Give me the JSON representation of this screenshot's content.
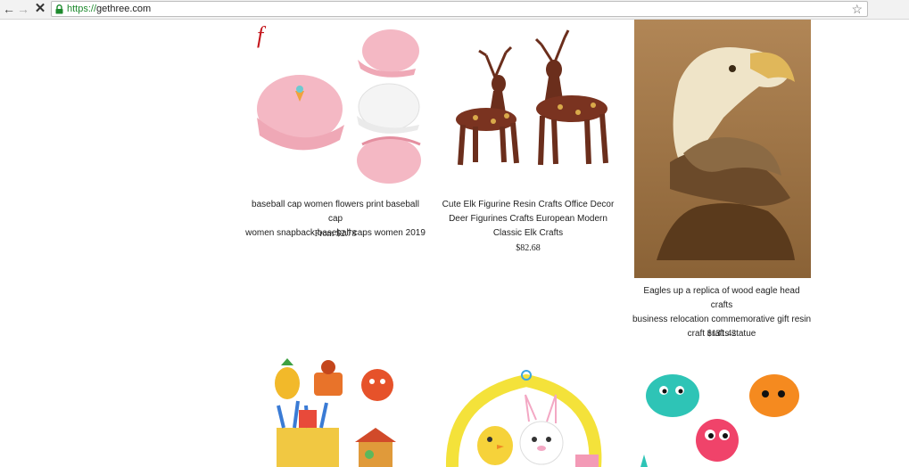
{
  "browser": {
    "url_scheme": "https://",
    "url_host": "gethree.com"
  },
  "products": [
    {
      "title_line1": "baseball cap women flowers print baseball cap",
      "title_line2": "women snapback baseball caps women 2019",
      "title_line3": "",
      "price": "From $2.78"
    },
    {
      "title_line1": "Cute Elk Figurine Resin Crafts Office Decor",
      "title_line2": "Deer Figurines Crafts European Modern",
      "title_line3": "Classic Elk Crafts",
      "price": "$82.68"
    },
    {
      "title_line1": "Eagles up a replica of wood eagle head crafts",
      "title_line2": "business relocation commemorative gift resin",
      "title_line3": "craft crafts statue",
      "price": "$131.42"
    }
  ],
  "colors": {
    "accent_green": "#1e8a2e",
    "cap_pink": "#f4b8c4",
    "elk_brown": "#6b2e1c",
    "eagle_bg": "#a57c4c"
  }
}
